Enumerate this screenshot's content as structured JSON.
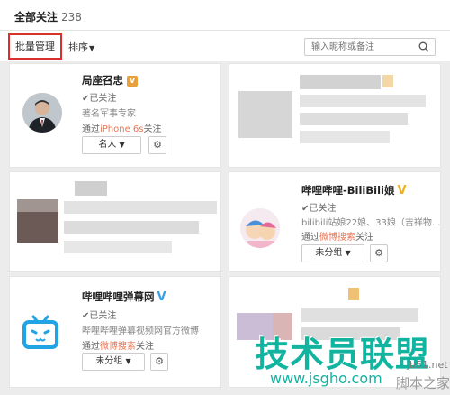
{
  "header": {
    "title": "全部关注",
    "count": "238"
  },
  "toolbar": {
    "batch_label": "批量管理",
    "sort_label": "排序"
  },
  "search": {
    "placeholder": "输入昵称或备注"
  },
  "cards": [
    {
      "name": "局座召忠",
      "status": "已关注",
      "desc": "著名军事专家",
      "via_prefix": "通过",
      "via_link": "iPhone 6s",
      "via_suffix": "关注",
      "group": "名人"
    },
    {
      "name": "哔哩哔哩-BiliBili娘",
      "status": "已关注",
      "desc": "bilibili站娘22娘、33娘（吉祥物...",
      "via_prefix": "通过",
      "via_link": "微博搜索",
      "via_suffix": "关注",
      "group": "未分组"
    },
    {
      "name": "哔哩哔哩弹幕网",
      "status": "已关注",
      "desc": "哔哩哔哩弹幕视频网官方微博",
      "via_prefix": "通过",
      "via_link": "微博搜索",
      "via_suffix": "关注",
      "group": "未分组"
    }
  ],
  "watermark": {
    "main": "技术员联盟",
    "url": "www.jsgho.com",
    "side": "jb51.net",
    "side2": "脚本之家"
  },
  "colors": {
    "accent": "#eb7350",
    "highlight_box": "#d9302c",
    "watermark": "#12b4a0"
  }
}
